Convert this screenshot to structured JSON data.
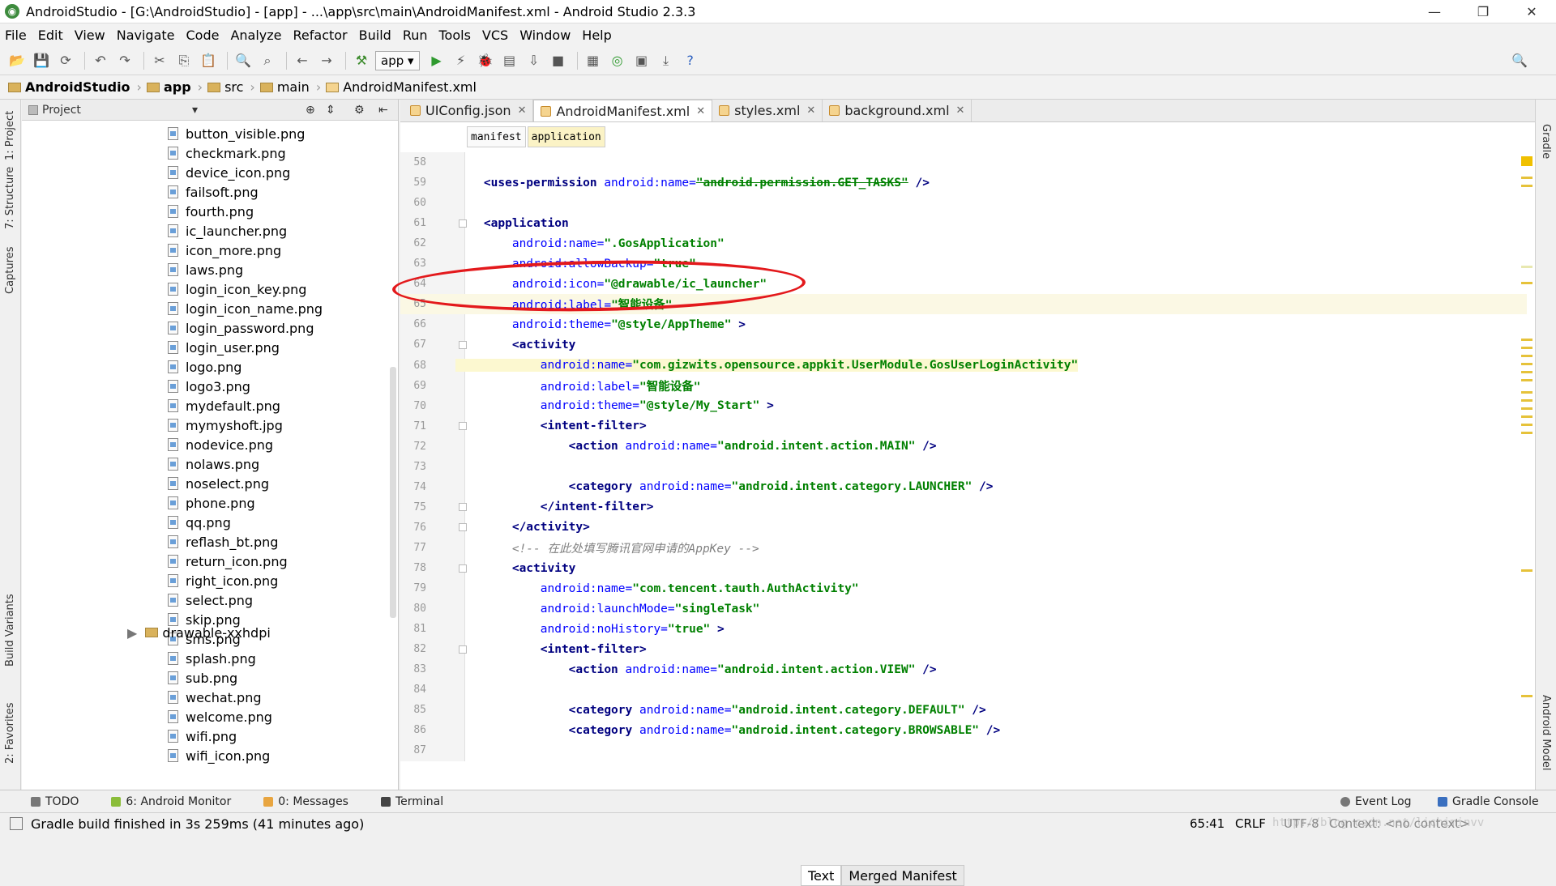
{
  "window": {
    "title": "AndroidStudio - [G:\\AndroidStudio] - [app] - ...\\app\\src\\main\\AndroidManifest.xml - Android Studio 2.3.3"
  },
  "menu": [
    "File",
    "Edit",
    "View",
    "Navigate",
    "Code",
    "Analyze",
    "Refactor",
    "Build",
    "Run",
    "Tools",
    "VCS",
    "Window",
    "Help"
  ],
  "toolbar": {
    "run_config": "app"
  },
  "nav": [
    "AndroidStudio",
    "app",
    "src",
    "main",
    "AndroidManifest.xml"
  ],
  "project_panel": {
    "title": "Project",
    "files": [
      "button_visible.png",
      "checkmark.png",
      "device_icon.png",
      "failsoft.png",
      "fourth.png",
      "ic_launcher.png",
      "icon_more.png",
      "laws.png",
      "login_icon_key.png",
      "login_icon_name.png",
      "login_password.png",
      "login_user.png",
      "logo.png",
      "logo3.png",
      "mydefault.png",
      "mymyshoft.jpg",
      "nodevice.png",
      "nolaws.png",
      "noselect.png",
      "phone.png",
      "qq.png",
      "reflash_bt.png",
      "return_icon.png",
      "right_icon.png",
      "select.png",
      "skip.png",
      "sms.png",
      "splash.png",
      "sub.png",
      "wechat.png",
      "welcome.png",
      "wifi.png",
      "wifi_icon.png"
    ],
    "folder": "drawable-xxhdpi"
  },
  "left_tools": [
    "1: Project",
    "7: Structure",
    "Captures",
    "Build Variants",
    "2: Favorites"
  ],
  "right_tools": [
    "Gradle",
    "Android Model"
  ],
  "editor": {
    "tabs": [
      "UIConfig.json",
      "AndroidManifest.xml",
      "styles.xml",
      "background.xml"
    ],
    "breadcrumbs": [
      "manifest",
      "application"
    ],
    "line_numbers": [
      "58",
      "59",
      "60",
      "61",
      "62",
      "63",
      "64",
      "65",
      "66",
      "67",
      "68",
      "69",
      "70",
      "71",
      "72",
      "73",
      "74",
      "75",
      "76",
      "77",
      "78",
      "79",
      "80",
      "81",
      "82",
      "83",
      "84",
      "85",
      "86",
      "87"
    ],
    "lines": [
      {
        "n": "58",
        "parts": []
      },
      {
        "n": "59",
        "parts": [
          {
            "c": "tag",
            "t": "    <uses-permission "
          },
          {
            "c": "attr",
            "t": "android:name="
          },
          {
            "c": "val del",
            "t": "\"android.permission.GET_TASKS\""
          },
          {
            "c": "tag",
            "t": " />"
          }
        ]
      },
      {
        "n": "60",
        "parts": []
      },
      {
        "n": "61",
        "parts": [
          {
            "c": "tag",
            "t": "    <application"
          }
        ]
      },
      {
        "n": "62",
        "parts": [
          {
            "c": "attr",
            "t": "        android:name="
          },
          {
            "c": "val",
            "t": "\".GosApplication\""
          }
        ]
      },
      {
        "n": "63",
        "parts": [
          {
            "c": "attr",
            "t": "        android:allowBackup="
          },
          {
            "c": "val",
            "t": "\"true\""
          }
        ]
      },
      {
        "n": "64",
        "parts": [
          {
            "c": "attr",
            "t": "        android:icon="
          },
          {
            "c": "val",
            "t": "\"@drawable/ic_launcher\""
          }
        ]
      },
      {
        "n": "65",
        "parts": [
          {
            "c": "attr",
            "t": "        android:label="
          },
          {
            "c": "val",
            "t": "\"智能设备\""
          }
        ]
      },
      {
        "n": "66",
        "parts": [
          {
            "c": "attr",
            "t": "        android:theme="
          },
          {
            "c": "val",
            "t": "\"@style/AppTheme\""
          },
          {
            "c": "tag",
            "t": " >"
          }
        ]
      },
      {
        "n": "67",
        "parts": [
          {
            "c": "tag",
            "t": "        <activity"
          }
        ]
      },
      {
        "n": "68",
        "parts": [
          {
            "c": "attr hl",
            "t": "            android:name="
          },
          {
            "c": "val hl",
            "t": "\"com.gizwits.opensource.appkit.UserModule.GosUserLoginActivity\""
          }
        ]
      },
      {
        "n": "69",
        "parts": [
          {
            "c": "attr",
            "t": "            android:label="
          },
          {
            "c": "val",
            "t": "\"智能设备\""
          }
        ]
      },
      {
        "n": "70",
        "parts": [
          {
            "c": "attr",
            "t": "            android:theme="
          },
          {
            "c": "val",
            "t": "\"@style/My_Start\""
          },
          {
            "c": "tag",
            "t": " >"
          }
        ]
      },
      {
        "n": "71",
        "parts": [
          {
            "c": "tag",
            "t": "            <intent-filter>"
          }
        ]
      },
      {
        "n": "72",
        "parts": [
          {
            "c": "tag",
            "t": "                <action "
          },
          {
            "c": "attr",
            "t": "android:name="
          },
          {
            "c": "val",
            "t": "\"android.intent.action.MAIN\""
          },
          {
            "c": "tag",
            "t": " />"
          }
        ]
      },
      {
        "n": "73",
        "parts": []
      },
      {
        "n": "74",
        "parts": [
          {
            "c": "tag",
            "t": "                <category "
          },
          {
            "c": "attr",
            "t": "android:name="
          },
          {
            "c": "val",
            "t": "\"android.intent.category.LAUNCHER\""
          },
          {
            "c": "tag",
            "t": " />"
          }
        ]
      },
      {
        "n": "75",
        "parts": [
          {
            "c": "tag",
            "t": "            </intent-filter>"
          }
        ]
      },
      {
        "n": "76",
        "parts": [
          {
            "c": "tag",
            "t": "        </activity>"
          }
        ]
      },
      {
        "n": "77",
        "parts": [
          {
            "c": "cmt",
            "t": "        <!-- 在此处填写腾讯官网申请的AppKey -->"
          }
        ]
      },
      {
        "n": "78",
        "parts": [
          {
            "c": "tag",
            "t": "        <activity"
          }
        ]
      },
      {
        "n": "79",
        "parts": [
          {
            "c": "attr",
            "t": "            android:name="
          },
          {
            "c": "val",
            "t": "\"com.tencent.tauth.AuthActivity\""
          }
        ]
      },
      {
        "n": "80",
        "parts": [
          {
            "c": "attr",
            "t": "            android:launchMode="
          },
          {
            "c": "val",
            "t": "\"singleTask\""
          }
        ]
      },
      {
        "n": "81",
        "parts": [
          {
            "c": "attr",
            "t": "            android:noHistory="
          },
          {
            "c": "val",
            "t": "\"true\""
          },
          {
            "c": "tag",
            "t": " >"
          }
        ]
      },
      {
        "n": "82",
        "parts": [
          {
            "c": "tag",
            "t": "            <intent-filter>"
          }
        ]
      },
      {
        "n": "83",
        "parts": [
          {
            "c": "tag",
            "t": "                <action "
          },
          {
            "c": "attr",
            "t": "android:name="
          },
          {
            "c": "val",
            "t": "\"android.intent.action.VIEW\""
          },
          {
            "c": "tag",
            "t": " />"
          }
        ]
      },
      {
        "n": "84",
        "parts": []
      },
      {
        "n": "85",
        "parts": [
          {
            "c": "tag",
            "t": "                <category "
          },
          {
            "c": "attr",
            "t": "android:name="
          },
          {
            "c": "val",
            "t": "\"android.intent.category.DEFAULT\""
          },
          {
            "c": "tag",
            "t": " />"
          }
        ]
      },
      {
        "n": "86",
        "parts": [
          {
            "c": "tag",
            "t": "                <category "
          },
          {
            "c": "attr",
            "t": "android:name="
          },
          {
            "c": "val",
            "t": "\"android.intent.category.BROWSABLE\""
          },
          {
            "c": "tag",
            "t": " />"
          }
        ]
      },
      {
        "n": "87",
        "parts": []
      }
    ],
    "bottom_tabs": [
      "Text",
      "Merged Manifest"
    ]
  },
  "tool_windows": {
    "left": [
      "TODO",
      "6: Android Monitor",
      "0: Messages",
      "Terminal"
    ],
    "right": [
      "Event Log",
      "Gradle Console"
    ]
  },
  "status": {
    "message": "Gradle build finished in 3s 259ms (41 minutes ago)",
    "position": "65:41",
    "line_sep": "CRLF",
    "encoding": "UTF-8",
    "context": "Context: <no context>",
    "watermark": "http://blog.csdn.net/lichiminvv"
  },
  "colors": {
    "tag": "#000080",
    "attr": "#0000ff",
    "value": "#008000",
    "annotation": "#e3191c"
  }
}
